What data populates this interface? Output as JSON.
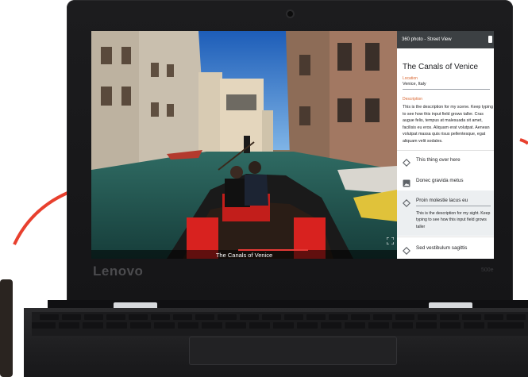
{
  "device": {
    "brand": "Lenovo",
    "model": "500e"
  },
  "app": {
    "header_label": "360 photo - Street View",
    "place_title": "The Canals of Venice",
    "location": {
      "label": "Location",
      "value": "Venice, Italy"
    },
    "description": {
      "label": "Description",
      "text": "This is the description for my scene. Keep typing to see how this input field grows taller. Cras augue felis, tempus at malesuada sit amet, facilisis eu eros. Aliquam erat volutpat. Aenean volutpat massa quis risus pellentesque, egat aliquam velit sodales."
    },
    "points_of_interest": [
      {
        "label": "This thing over here",
        "icon": "diamond-icon",
        "selected": false
      },
      {
        "label": "Donec gravida metus",
        "icon": "image-icon",
        "selected": false
      },
      {
        "label": "Proin molestie lacus eu",
        "icon": "diamond-icon",
        "selected": true,
        "description": "This is the description for my sight. Keep typing to see how this input field grows taller"
      },
      {
        "label": "Sed vestibulum sagittis",
        "icon": "diamond-icon",
        "selected": false
      }
    ],
    "caption": "The Canals of Venice",
    "fullscreen_icon": "fullscreen-icon"
  },
  "colors": {
    "accent": "#d9652f",
    "progress": "#e53935",
    "panel_header": "#3c4043",
    "background_arc": "#e8402e"
  }
}
